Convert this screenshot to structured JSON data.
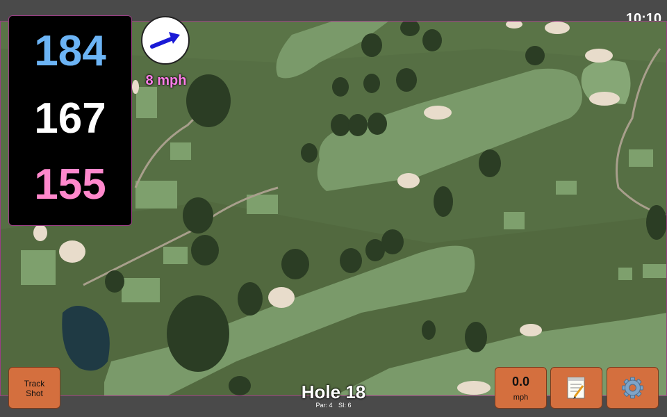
{
  "status_bar": {
    "time": "10:10"
  },
  "distances": {
    "back": "184",
    "middle": "167",
    "front": "155"
  },
  "wind": {
    "speed_label": "8 mph",
    "direction_icon": "wind-arrow-icon",
    "colors": {
      "speed_text": "#ff7ee8"
    }
  },
  "distance_colors": {
    "back": "#6cb4f5",
    "middle": "#ffffff",
    "front": "#ff88cc"
  },
  "buttons": {
    "track_shot_line1": "Track",
    "track_shot_line2": "Shot",
    "speed_value": "0.0",
    "speed_unit": "mph",
    "notes_icon": "notepad-icon",
    "settings_icon": "gear-icon"
  },
  "hole": {
    "title": "Hole 18",
    "par": "Par: 4",
    "stroke_index": "SI: 6"
  },
  "accent_color": "#d46f3e"
}
